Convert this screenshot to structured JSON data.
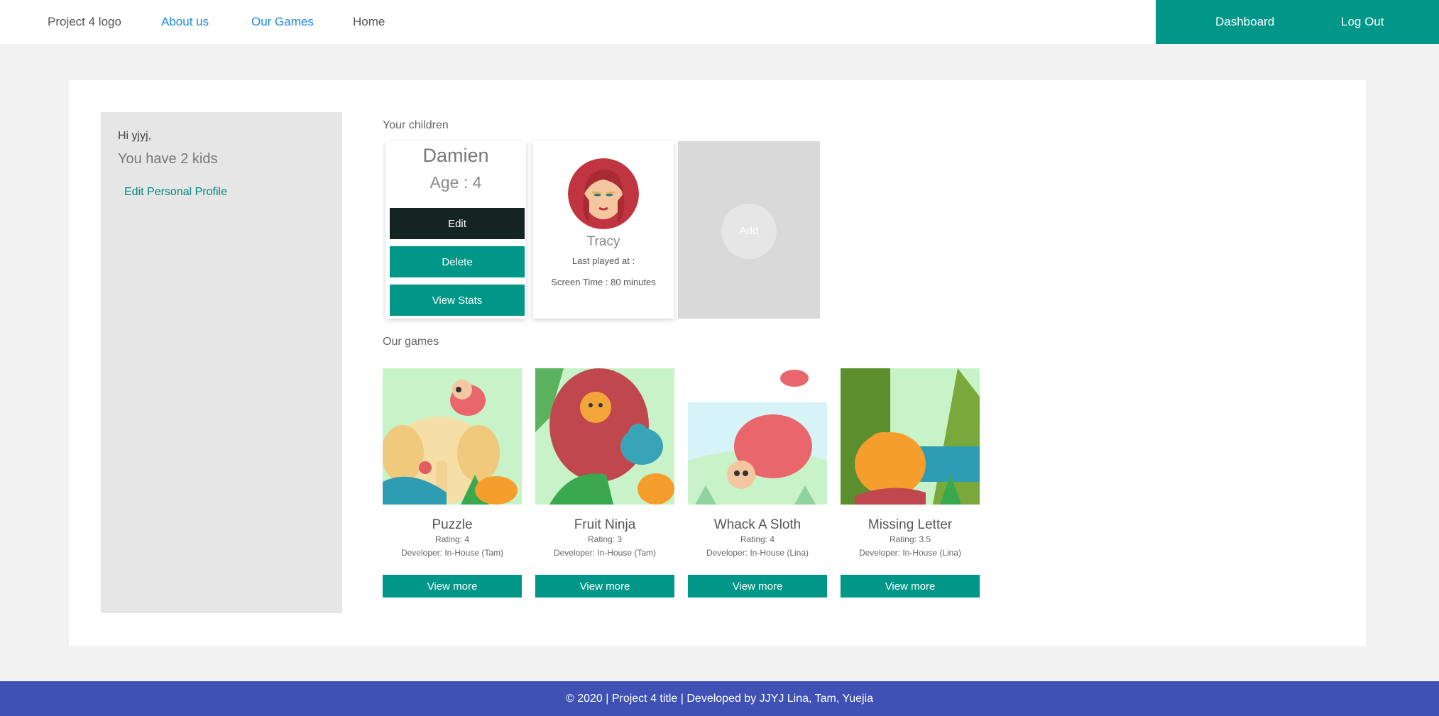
{
  "nav": {
    "logo": "Project 4 logo",
    "links": [
      "About us",
      "Our Games",
      "Home"
    ],
    "dashboard": "Dashboard",
    "logout": "Log Out",
    "accent_color": "#009688",
    "link_color": "#1e88e5"
  },
  "sidebar": {
    "greeting": "Hi yjyj,",
    "kids_count_text": "You have 2 kids",
    "edit_profile": "Edit Personal Profile"
  },
  "children_section": {
    "title": "Your children",
    "children": [
      {
        "name": "Damien",
        "age": "Age : 4",
        "buttons": [
          "Edit",
          "Delete",
          "View Stats"
        ]
      },
      {
        "name": "Tracy",
        "last_played": "Last played at :",
        "screen_time": "Screen Time : 80 minutes",
        "avatar": "girl-avatar-icon"
      }
    ],
    "add_label": "Add"
  },
  "games_section": {
    "title": "Our games",
    "games": [
      {
        "title": "Puzzle",
        "rating": "Rating: 4",
        "developer": "Developer: In-House (Tam)",
        "button": "View more"
      },
      {
        "title": "Fruit Ninja",
        "rating": "Rating: 3",
        "developer": "Developer: In-House (Tam)",
        "button": "View more"
      },
      {
        "title": "Whack A Sloth",
        "rating": "Rating: 4",
        "developer": "Developer: In-House (Lina)",
        "button": "View more"
      },
      {
        "title": "Missing Letter",
        "rating": "Rating: 3.5",
        "developer": "Developer: In-House (Lina)",
        "button": "View more"
      }
    ]
  },
  "footer": {
    "text": "© 2020 | Project 4 title | Developed by JJYJ Lina, Tam, Yuejia",
    "color": "#3f51b5"
  }
}
